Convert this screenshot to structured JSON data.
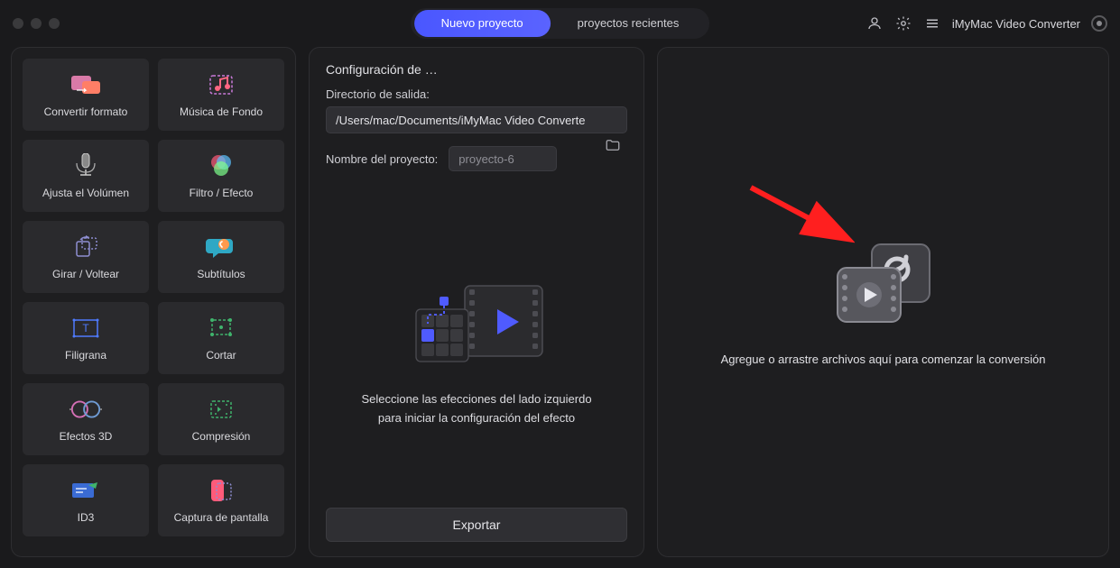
{
  "header": {
    "tab_new": "Nuevo proyecto",
    "tab_recent": "proyectos recientes",
    "app_name": "iMyMac Video Converter"
  },
  "sidebar": {
    "tools": [
      {
        "id": "convert-format",
        "label": "Convertir formato",
        "icon": "convert"
      },
      {
        "id": "bg-music",
        "label": "Música de Fondo",
        "icon": "music"
      },
      {
        "id": "adjust-volume",
        "label": "Ajusta el Volúmen",
        "icon": "volume"
      },
      {
        "id": "filter-effect",
        "label": "Filtro / Efecto",
        "icon": "filter"
      },
      {
        "id": "rotate-flip",
        "label": "Girar / Voltear",
        "icon": "rotate"
      },
      {
        "id": "subtitles",
        "label": "Subtítulos",
        "icon": "subtitle"
      },
      {
        "id": "watermark",
        "label": "Filigrana",
        "icon": "watermark"
      },
      {
        "id": "cut",
        "label": "Cortar",
        "icon": "crop"
      },
      {
        "id": "3d-effects",
        "label": "Efectos 3D",
        "icon": "3d"
      },
      {
        "id": "compression",
        "label": "Compresión",
        "icon": "compress"
      },
      {
        "id": "id3",
        "label": "ID3",
        "icon": "id3"
      },
      {
        "id": "screenshot",
        "label": "Captura de pantalla",
        "icon": "capture"
      }
    ]
  },
  "config": {
    "title": "Configuración de …",
    "output_dir_label": "Directorio de salida:",
    "output_dir_value": "/Users/mac/Documents/iMyMac Video Converte",
    "project_name_label": "Nombre del proyecto:",
    "project_name_value": "proyecto-6",
    "hint_line1": "Seleccione las efecciones del lado izquierdo",
    "hint_line2": "para iniciar la configuración del efecto",
    "export_label": "Exportar"
  },
  "drop": {
    "text": "Agregue o arrastre archivos aquí para comenzar la conversión"
  },
  "colors": {
    "accent": "#4f5bff",
    "arrow": "#ff1f1f"
  }
}
